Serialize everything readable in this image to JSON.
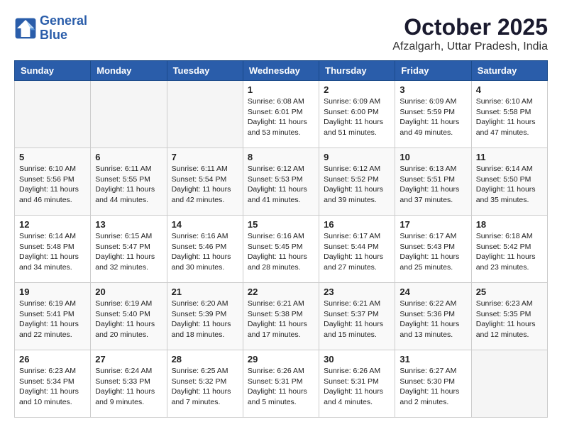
{
  "header": {
    "logo_line1": "General",
    "logo_line2": "Blue",
    "title": "October 2025",
    "subtitle": "Afzalgarh, Uttar Pradesh, India"
  },
  "weekdays": [
    "Sunday",
    "Monday",
    "Tuesday",
    "Wednesday",
    "Thursday",
    "Friday",
    "Saturday"
  ],
  "weeks": [
    [
      {
        "day": "",
        "info": ""
      },
      {
        "day": "",
        "info": ""
      },
      {
        "day": "",
        "info": ""
      },
      {
        "day": "1",
        "info": "Sunrise: 6:08 AM\nSunset: 6:01 PM\nDaylight: 11 hours\nand 53 minutes."
      },
      {
        "day": "2",
        "info": "Sunrise: 6:09 AM\nSunset: 6:00 PM\nDaylight: 11 hours\nand 51 minutes."
      },
      {
        "day": "3",
        "info": "Sunrise: 6:09 AM\nSunset: 5:59 PM\nDaylight: 11 hours\nand 49 minutes."
      },
      {
        "day": "4",
        "info": "Sunrise: 6:10 AM\nSunset: 5:58 PM\nDaylight: 11 hours\nand 47 minutes."
      }
    ],
    [
      {
        "day": "5",
        "info": "Sunrise: 6:10 AM\nSunset: 5:56 PM\nDaylight: 11 hours\nand 46 minutes."
      },
      {
        "day": "6",
        "info": "Sunrise: 6:11 AM\nSunset: 5:55 PM\nDaylight: 11 hours\nand 44 minutes."
      },
      {
        "day": "7",
        "info": "Sunrise: 6:11 AM\nSunset: 5:54 PM\nDaylight: 11 hours\nand 42 minutes."
      },
      {
        "day": "8",
        "info": "Sunrise: 6:12 AM\nSunset: 5:53 PM\nDaylight: 11 hours\nand 41 minutes."
      },
      {
        "day": "9",
        "info": "Sunrise: 6:12 AM\nSunset: 5:52 PM\nDaylight: 11 hours\nand 39 minutes."
      },
      {
        "day": "10",
        "info": "Sunrise: 6:13 AM\nSunset: 5:51 PM\nDaylight: 11 hours\nand 37 minutes."
      },
      {
        "day": "11",
        "info": "Sunrise: 6:14 AM\nSunset: 5:50 PM\nDaylight: 11 hours\nand 35 minutes."
      }
    ],
    [
      {
        "day": "12",
        "info": "Sunrise: 6:14 AM\nSunset: 5:48 PM\nDaylight: 11 hours\nand 34 minutes."
      },
      {
        "day": "13",
        "info": "Sunrise: 6:15 AM\nSunset: 5:47 PM\nDaylight: 11 hours\nand 32 minutes."
      },
      {
        "day": "14",
        "info": "Sunrise: 6:16 AM\nSunset: 5:46 PM\nDaylight: 11 hours\nand 30 minutes."
      },
      {
        "day": "15",
        "info": "Sunrise: 6:16 AM\nSunset: 5:45 PM\nDaylight: 11 hours\nand 28 minutes."
      },
      {
        "day": "16",
        "info": "Sunrise: 6:17 AM\nSunset: 5:44 PM\nDaylight: 11 hours\nand 27 minutes."
      },
      {
        "day": "17",
        "info": "Sunrise: 6:17 AM\nSunset: 5:43 PM\nDaylight: 11 hours\nand 25 minutes."
      },
      {
        "day": "18",
        "info": "Sunrise: 6:18 AM\nSunset: 5:42 PM\nDaylight: 11 hours\nand 23 minutes."
      }
    ],
    [
      {
        "day": "19",
        "info": "Sunrise: 6:19 AM\nSunset: 5:41 PM\nDaylight: 11 hours\nand 22 minutes."
      },
      {
        "day": "20",
        "info": "Sunrise: 6:19 AM\nSunset: 5:40 PM\nDaylight: 11 hours\nand 20 minutes."
      },
      {
        "day": "21",
        "info": "Sunrise: 6:20 AM\nSunset: 5:39 PM\nDaylight: 11 hours\nand 18 minutes."
      },
      {
        "day": "22",
        "info": "Sunrise: 6:21 AM\nSunset: 5:38 PM\nDaylight: 11 hours\nand 17 minutes."
      },
      {
        "day": "23",
        "info": "Sunrise: 6:21 AM\nSunset: 5:37 PM\nDaylight: 11 hours\nand 15 minutes."
      },
      {
        "day": "24",
        "info": "Sunrise: 6:22 AM\nSunset: 5:36 PM\nDaylight: 11 hours\nand 13 minutes."
      },
      {
        "day": "25",
        "info": "Sunrise: 6:23 AM\nSunset: 5:35 PM\nDaylight: 11 hours\nand 12 minutes."
      }
    ],
    [
      {
        "day": "26",
        "info": "Sunrise: 6:23 AM\nSunset: 5:34 PM\nDaylight: 11 hours\nand 10 minutes."
      },
      {
        "day": "27",
        "info": "Sunrise: 6:24 AM\nSunset: 5:33 PM\nDaylight: 11 hours\nand 9 minutes."
      },
      {
        "day": "28",
        "info": "Sunrise: 6:25 AM\nSunset: 5:32 PM\nDaylight: 11 hours\nand 7 minutes."
      },
      {
        "day": "29",
        "info": "Sunrise: 6:26 AM\nSunset: 5:31 PM\nDaylight: 11 hours\nand 5 minutes."
      },
      {
        "day": "30",
        "info": "Sunrise: 6:26 AM\nSunset: 5:31 PM\nDaylight: 11 hours\nand 4 minutes."
      },
      {
        "day": "31",
        "info": "Sunrise: 6:27 AM\nSunset: 5:30 PM\nDaylight: 11 hours\nand 2 minutes."
      },
      {
        "day": "",
        "info": ""
      }
    ]
  ]
}
